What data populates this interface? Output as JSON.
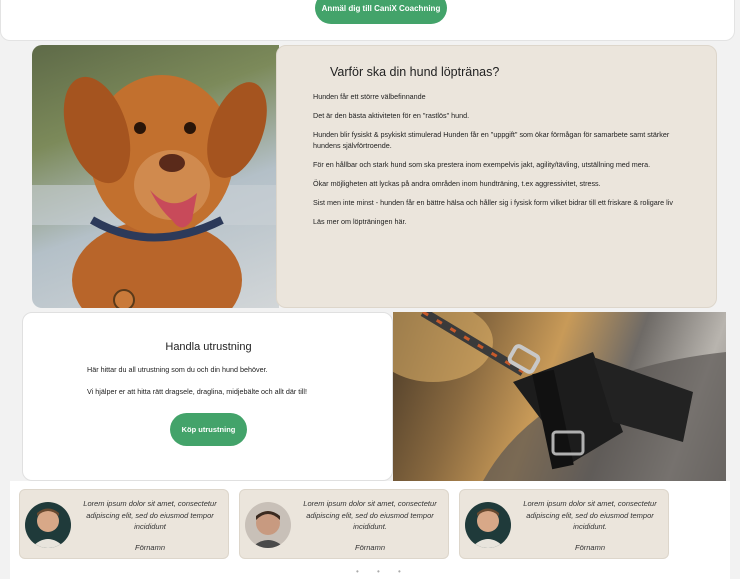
{
  "top": {
    "button_label": "Anmäl dig till CaniX Coachning"
  },
  "why": {
    "title": "Varför ska din hund löptränas?",
    "items": [
      "Hunden får ett större välbefinnande",
      "Det är den bästa aktiviteten för en \"rastlös\" hund.",
      "Hunden blir fysiskt & psykiskt stimulerad Hunden får en \"uppgift\" som ökar förmågan för samarbete samt stärker hundens självförtroende.",
      "För en hållbar och stark hund som ska prestera inom exempelvis jakt, agility/tävling, utställning med mera.",
      "Ökar möjligheten att lyckas på andra områden inom hundträning, t.ex aggressivitet, stress.",
      "Sist men inte minst - hunden får en bättre hälsa och håller sig i fysisk form vilket bidrar till ett friskare & roligare liv",
      "Läs mer om löpträningen här."
    ]
  },
  "shop": {
    "title": "Handla utrustning",
    "line1": "Här hittar du all utrustning som du och din hund behöver.",
    "line2": "Vi hjälper er att hitta rätt dragsele, draglina, midjebälte och allt där till!",
    "button_label": "Köp utrustning"
  },
  "testimonials": [
    {
      "quote": "Lorem ipsum dolor sit amet, consectetur adipiscing elit, sed do eiusmod tempor incididunt",
      "name": "Förnamn"
    },
    {
      "quote": "Lorem ipsum dolor sit amet, consectetur adipiscing elit, sed do eiusmod tempor incididunt.",
      "name": "Förnamn"
    },
    {
      "quote": "Lorem ipsum dolor sit amet, consectetur adipiscing elit, sed do eiusmod tempor incididunt.",
      "name": "Förnamn"
    }
  ],
  "carousel": {
    "dots": "• • •"
  },
  "colors": {
    "accent_green": "#43a36a",
    "card_beige": "#ebe5dc"
  }
}
